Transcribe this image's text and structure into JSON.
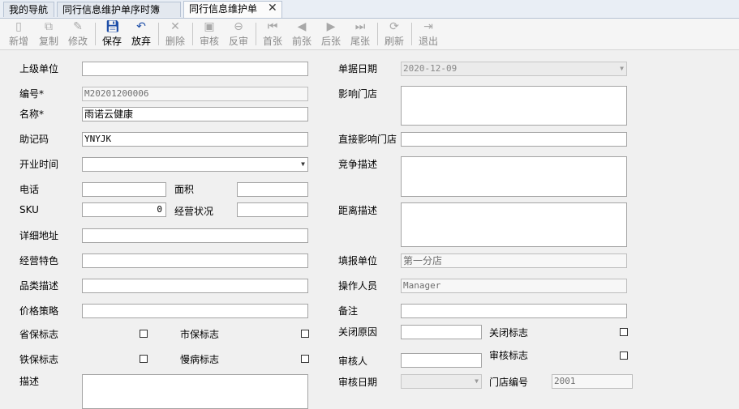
{
  "tabs": [
    {
      "label": "我的导航"
    },
    {
      "label": "同行信息维护单序时簿"
    },
    {
      "label": "同行信息维护单"
    }
  ],
  "toolbar": {
    "new": "新增",
    "copy": "复制",
    "edit": "修改",
    "save": "保存",
    "discard": "放弃",
    "delete": "删除",
    "audit": "审核",
    "unaudit": "反审",
    "first": "首张",
    "prev": "前张",
    "next": "后张",
    "last": "尾张",
    "refresh": "刷新",
    "exit": "退出"
  },
  "icons": {
    "new": "new-doc-icon",
    "copy": "copy-icon",
    "edit": "edit-icon",
    "save": "floppy-icon",
    "discard": "undo-icon",
    "delete": "x-icon",
    "audit": "audit-icon",
    "unaudit": "unaudit-icon",
    "first": "first-icon",
    "prev": "prev-icon",
    "next": "next-icon",
    "last": "last-icon",
    "refresh": "refresh-icon",
    "exit": "exit-icon"
  },
  "form": {
    "parent_unit": {
      "label": "上级单位",
      "value": ""
    },
    "code": {
      "label": "编号*",
      "value": "M20201200006"
    },
    "name": {
      "label": "名称*",
      "value": "雨诺云健康"
    },
    "mnemonic": {
      "label": "助记码",
      "value": "YNYJK"
    },
    "open_time": {
      "label": "开业时间",
      "value": ""
    },
    "phone": {
      "label": "电话",
      "value": ""
    },
    "area": {
      "label": "面积",
      "value": ""
    },
    "sku": {
      "label": "SKU",
      "value": "0"
    },
    "biz_status": {
      "label": "经营状况",
      "value": ""
    },
    "address": {
      "label": "详细地址",
      "value": ""
    },
    "features": {
      "label": "经营特色",
      "value": ""
    },
    "category_desc": {
      "label": "品类描述",
      "value": ""
    },
    "price_strategy": {
      "label": "价格策略",
      "value": ""
    },
    "prov_insurance": {
      "label": "省保标志"
    },
    "city_insurance": {
      "label": "市保标志"
    },
    "rail_insurance": {
      "label": "铁保标志"
    },
    "chronic": {
      "label": "慢病标志"
    },
    "description": {
      "label": "描述",
      "value": ""
    },
    "doc_date": {
      "label": "单据日期",
      "value": "2020-12-09"
    },
    "affected_stores": {
      "label": "影响门店",
      "value": ""
    },
    "direct_affected": {
      "label": "直接影响门店",
      "value": ""
    },
    "competition_desc": {
      "label": "竞争描述",
      "value": ""
    },
    "distance_desc": {
      "label": "距离描述",
      "value": ""
    },
    "report_unit": {
      "label": "填报单位",
      "value": "第一分店"
    },
    "operator": {
      "label": "操作人员",
      "value": "Manager"
    },
    "remark": {
      "label": "备注",
      "value": ""
    },
    "close_reason": {
      "label": "关闭原因",
      "value": ""
    },
    "close_flag": {
      "label": "关闭标志"
    },
    "auditor": {
      "label": "审核人",
      "value": ""
    },
    "audit_flag": {
      "label": "审核标志"
    },
    "audit_date": {
      "label": "审核日期",
      "value": ""
    },
    "store_code": {
      "label": "门店编号",
      "value": "2001"
    }
  }
}
